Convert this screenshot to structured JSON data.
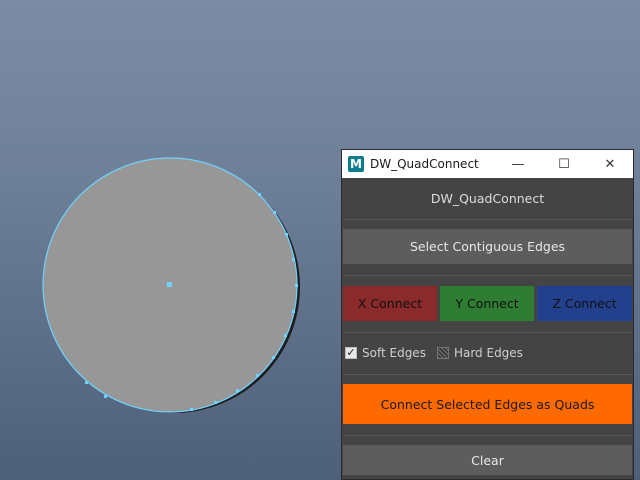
{
  "colors": {
    "viewport_top": "#7a8ba3",
    "viewport_bottom": "#4e6079",
    "disc_fill": "#979797",
    "selection_outline": "#6fd3ff",
    "panel_bg": "#444444",
    "button_gray": "#5d5d5d",
    "x_connect": "#8b2a2a",
    "y_connect": "#2e7d32",
    "z_connect": "#23408e",
    "orange_button": "#ff6a00"
  },
  "viewport": {
    "object": "disc"
  },
  "window": {
    "app_icon_letter": "M",
    "app_icon": "maya-icon",
    "title": "DW_QuadConnect",
    "minimize_glyph": "—",
    "maximize_glyph": "☐",
    "close_glyph": "✕"
  },
  "panel": {
    "header": "DW_QuadConnect",
    "select_contiguous": "Select Contiguous Edges",
    "x_connect": "X Connect",
    "y_connect": "Y Connect",
    "z_connect": "Z Connect",
    "soft_edges": {
      "label": "Soft Edges",
      "checked": true,
      "glyph": "✓"
    },
    "hard_edges": {
      "label": "Hard Edges",
      "checked": false
    },
    "connect_quads": "Connect Selected Edges as Quads",
    "clear": "Clear"
  }
}
